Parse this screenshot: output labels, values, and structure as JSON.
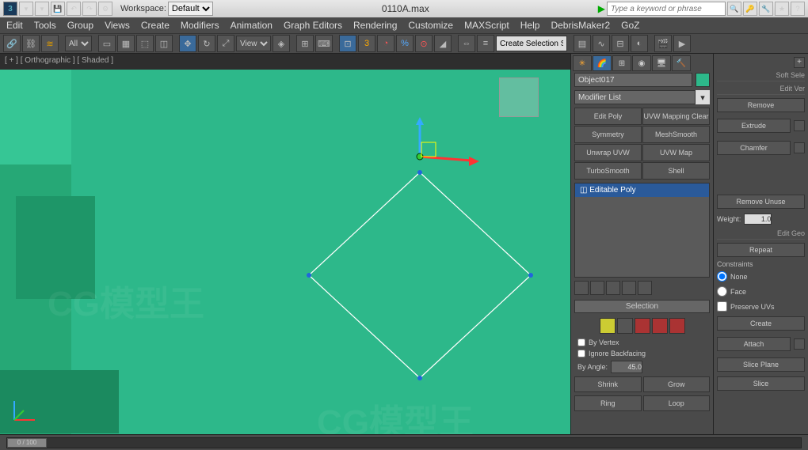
{
  "titlebar": {
    "ws_label": "Workspace:",
    "workspace": "Default",
    "filename": "0110A.max",
    "search_placeholder": "Type a keyword or phrase"
  },
  "menu": [
    "Edit",
    "Tools",
    "Group",
    "Views",
    "Create",
    "Modifiers",
    "Animation",
    "Graph Editors",
    "Rendering",
    "Customize",
    "MAXScript",
    "Help",
    "DebrisMaker2",
    "GoZ"
  ],
  "toolbar": {
    "all_label": "All",
    "view_label": "View",
    "snap_num": "3",
    "create_sel": "Create Selection S"
  },
  "viewport": {
    "label": "[ + ] [ Orthographic ] [ Shaded ]"
  },
  "panel": {
    "object_name": "Object017",
    "modifier_list": "Modifier List",
    "mod_buttons": [
      "Edit Poly",
      "UVW Mapping Clear",
      "Symmetry",
      "MeshSmooth",
      "Unwrap UVW",
      "UVW Map",
      "TurboSmooth",
      "Shell"
    ],
    "stack_item": "Editable Poly",
    "rollout_selection": "Selection",
    "by_vertex": "By Vertex",
    "ignore_backfacing": "Ignore Backfacing",
    "angle_val": "45.0",
    "shrink": "Shrink",
    "grow": "Grow",
    "ring": "Ring",
    "loop": "Loop"
  },
  "side": {
    "soft_sel": "Soft Sele",
    "edit_ver": "Edit Ver",
    "remove": "Remove",
    "extrude": "Extrude",
    "chamfer": "Chamfer",
    "remove_unused": "Remove Unuse",
    "weight": "Weight:",
    "weight_val": "1.0",
    "edit_geo": "Edit Geo",
    "repeat": "Repeat",
    "constraints": "Constraints",
    "none": "None",
    "face": "Face",
    "preserve_uvs": "Preserve UVs",
    "create": "Create",
    "attach": "Attach",
    "slice_plane": "Slice Plane",
    "slice": "Slice"
  },
  "bottom": {
    "frame": "0 / 100"
  }
}
